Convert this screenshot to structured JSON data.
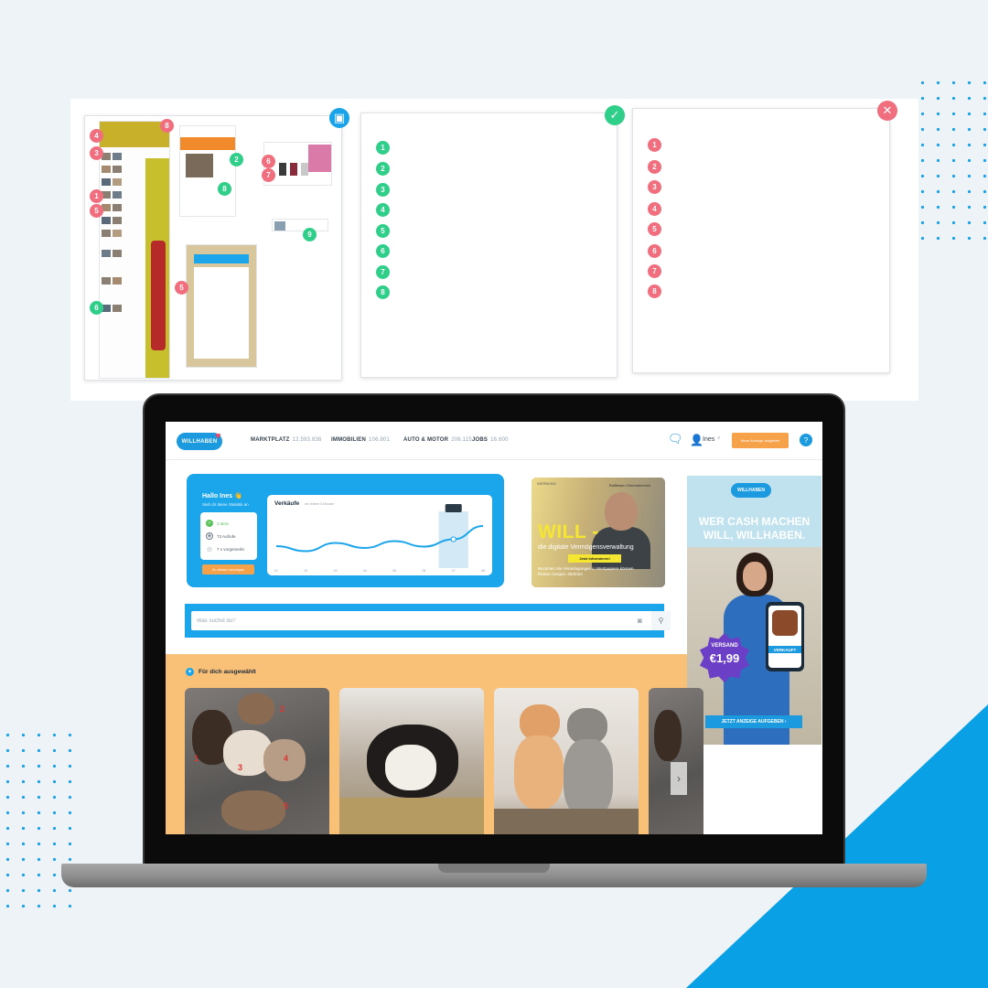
{
  "board": {
    "panel2_items": [
      "1",
      "2",
      "3",
      "4",
      "5",
      "6",
      "7",
      "8"
    ],
    "panel3_items": [
      "1",
      "2",
      "3",
      "4",
      "5",
      "6",
      "7",
      "8"
    ],
    "panel1_badges": [
      "8",
      "4",
      "2",
      "3",
      "6",
      "7",
      "1",
      "5",
      "8",
      "9",
      "5",
      "6"
    ]
  },
  "nav": {
    "logo": "WILLHABEN",
    "links": [
      {
        "label": "MARKTPLATZ",
        "count": "12.593.836"
      },
      {
        "label": "IMMOBILIEN",
        "count": "106.801"
      },
      {
        "label": "AUTO & MOTOR",
        "count": "206.115"
      },
      {
        "label": "JOBS",
        "count": "16.600"
      }
    ],
    "user": "Ines",
    "post_button": "Neue Anzeige aufgeben"
  },
  "stats": {
    "greeting": "Hallo Ines 👋",
    "subtitle": "Sieh dir deine Statistik an",
    "active": "3 aktiv",
    "views": "73 Aufrufe",
    "saved": "7 x vorgemerkt",
    "button": "Zu deinen Anzeigen",
    "chart_title": "Verkäufe",
    "chart_subtitle": "der letzten 8 Monate"
  },
  "chart_data": {
    "type": "line",
    "title": "Verkäufe",
    "subtitle": "der letzten 8 Monate",
    "categories": [
      "01",
      "02",
      "03",
      "04",
      "05",
      "06",
      "07",
      "08"
    ],
    "values": [
      3.2,
      2.1,
      3.9,
      2.8,
      4.3,
      3.1,
      4.7,
      7.6
    ],
    "ylim": [
      0,
      10
    ],
    "grid": false,
    "highlight_index": 6
  },
  "ad1": {
    "label": "WERBUNG",
    "brand": "Raiffeisen Oberösterreich",
    "headline": "WILL -",
    "tagline": "die digitale Vermögensverwaltung",
    "cta": "Jetzt informieren!",
    "fine": "Bezahlen Sie Veranlagungen in Wertpapiere können Risiken bergen. 05/2023"
  },
  "ad2": {
    "logo": "WILLHABEN",
    "line1": "WER CASH MACHEN",
    "line2": "WILL, WILLHABEN.",
    "badge_top": "VERSAND",
    "badge_price": "€1,99",
    "sold": "VERKAUFT",
    "cta": "JETZT ANZEIGE AUFGEBEN ›"
  },
  "search": {
    "placeholder": "Was suchst du?"
  },
  "foryou": {
    "title": "Für dich ausgewählt",
    "card1_labels": [
      "1",
      "2",
      "3",
      "4",
      "5"
    ]
  },
  "colors": {
    "brand_blue": "#1ba5ea",
    "accent_orange": "#f5a24b",
    "section_bg": "#f9c078"
  }
}
